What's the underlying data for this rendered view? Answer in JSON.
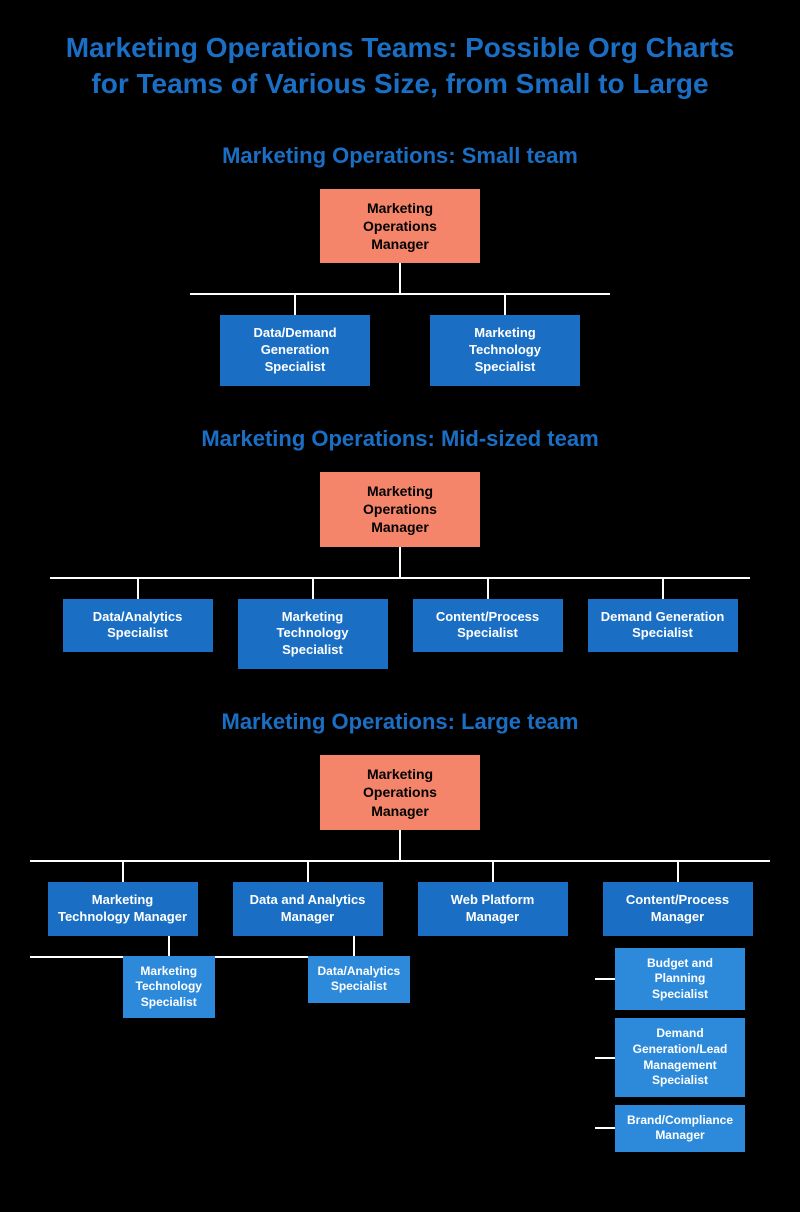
{
  "page": {
    "title": "Marketing Operations Teams: Possible Org Charts for Teams of Various Size, from Small to Large"
  },
  "small_team": {
    "section_title": "Marketing Operations: Small team",
    "root": "Marketing Operations Manager",
    "children": [
      "Data/Demand Generation Specialist",
      "Marketing Technology Specialist"
    ]
  },
  "mid_team": {
    "section_title": "Marketing Operations: Mid-sized team",
    "root": "Marketing Operations Manager",
    "children": [
      "Data/Analytics Specialist",
      "Marketing Technology Specialist",
      "Content/Process Specialist",
      "Demand Generation Specialist"
    ]
  },
  "large_team": {
    "section_title": "Marketing Operations: Large team",
    "root": "Marketing Operations Manager",
    "managers": [
      {
        "title": "Marketing Technology Manager",
        "children": [
          "Marketing Technology Specialist"
        ]
      },
      {
        "title": "Data and Analytics Manager",
        "children": [
          "Data/Analytics Specialist"
        ]
      },
      {
        "title": "Web Platform Manager",
        "children": []
      },
      {
        "title": "Content/Process Manager",
        "children": [
          "Budget and Planning Specialist",
          "Demand Generation/Lead Management Specialist",
          "Brand/Compliance Manager"
        ]
      }
    ]
  }
}
